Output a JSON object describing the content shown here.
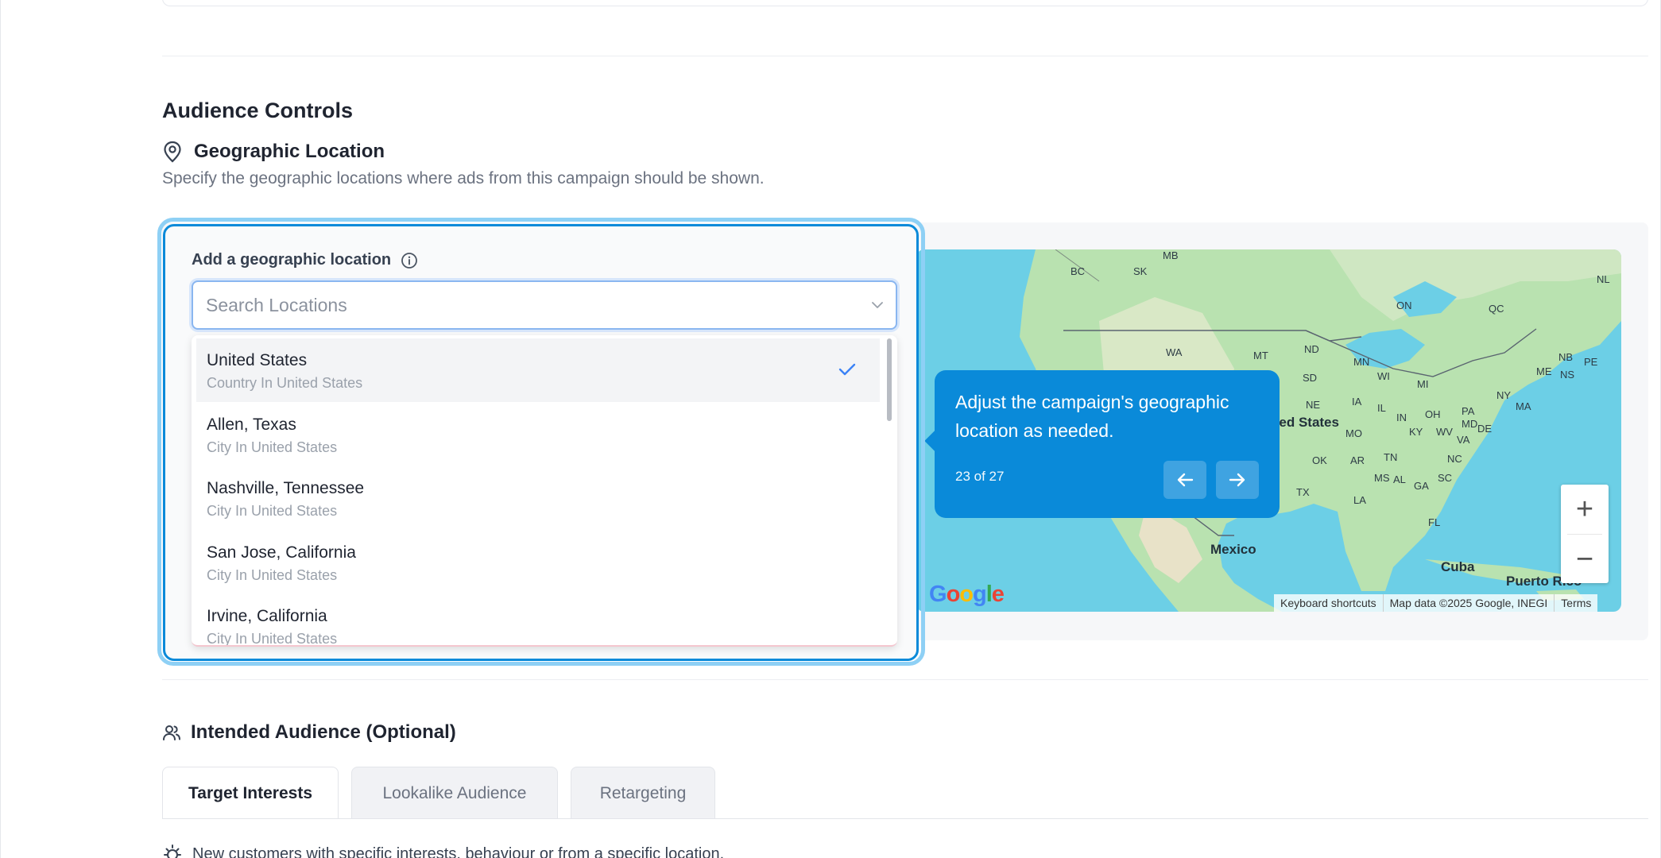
{
  "section": {
    "title": "Audience Controls"
  },
  "geo": {
    "heading": "Geographic Location",
    "description": "Specify the geographic locations where ads from this campaign should be shown.",
    "field_label": "Add a geographic location",
    "search_placeholder": "Search Locations",
    "options": [
      {
        "title": "United States",
        "subtitle": "Country In United States",
        "selected": true
      },
      {
        "title": "Allen, Texas",
        "subtitle": "City In United States",
        "selected": false
      },
      {
        "title": "Nashville, Tennessee",
        "subtitle": "City In United States",
        "selected": false
      },
      {
        "title": "San Jose, California",
        "subtitle": "City In United States",
        "selected": false
      },
      {
        "title": "Irvine, California",
        "subtitle": "City In United States",
        "selected": false
      }
    ]
  },
  "tour": {
    "message": "Adjust the campaign's geographic location as needed.",
    "step": "23 of 27"
  },
  "map": {
    "labels": {
      "mb": "MB",
      "bc": "BC",
      "sk": "SK",
      "nl": "NL",
      "on": "ON",
      "qc": "QC",
      "wa": "WA",
      "mt": "MT",
      "nd": "ND",
      "mn": "MN",
      "sd": "SD",
      "wi": "WI",
      "mi": "MI",
      "ne": "NE",
      "ia": "IA",
      "us": "ited States",
      "mo": "MO",
      "il": "IL",
      "in": "IN",
      "oh": "OH",
      "pa": "PA",
      "ny": "NY",
      "ma": "MA",
      "me": "ME",
      "nb": "NB",
      "ns": "NS",
      "pe": "PE",
      "ok": "OK",
      "ar": "AR",
      "tn": "TN",
      "ky": "KY",
      "wv": "WV",
      "va": "VA",
      "md": "MD",
      "de": "DE",
      "nc": "NC",
      "tx": "TX",
      "la": "LA",
      "ms": "MS",
      "al": "AL",
      "ga": "GA",
      "sc": "SC",
      "fl": "FL",
      "mexico": "Mexico",
      "cuba": "Cuba",
      "pr": "Puerto Rico"
    },
    "attribution": {
      "shortcuts": "Keyboard shortcuts",
      "data": "Map data ©2025 Google, INEGI",
      "terms": "Terms"
    },
    "zoom_in": "+",
    "zoom_out": "−"
  },
  "audience": {
    "heading": "Intended Audience (Optional)",
    "tabs": [
      "Target Interests",
      "Lookalike Audience",
      "Retargeting"
    ],
    "interests_description": "New customers with specific interests, behaviour or from a specific location."
  },
  "colors": {
    "accent": "#0a8ad9",
    "highlight": "#8ed0f5",
    "water": "#6ccfe6",
    "land": "#b9e2b0"
  }
}
